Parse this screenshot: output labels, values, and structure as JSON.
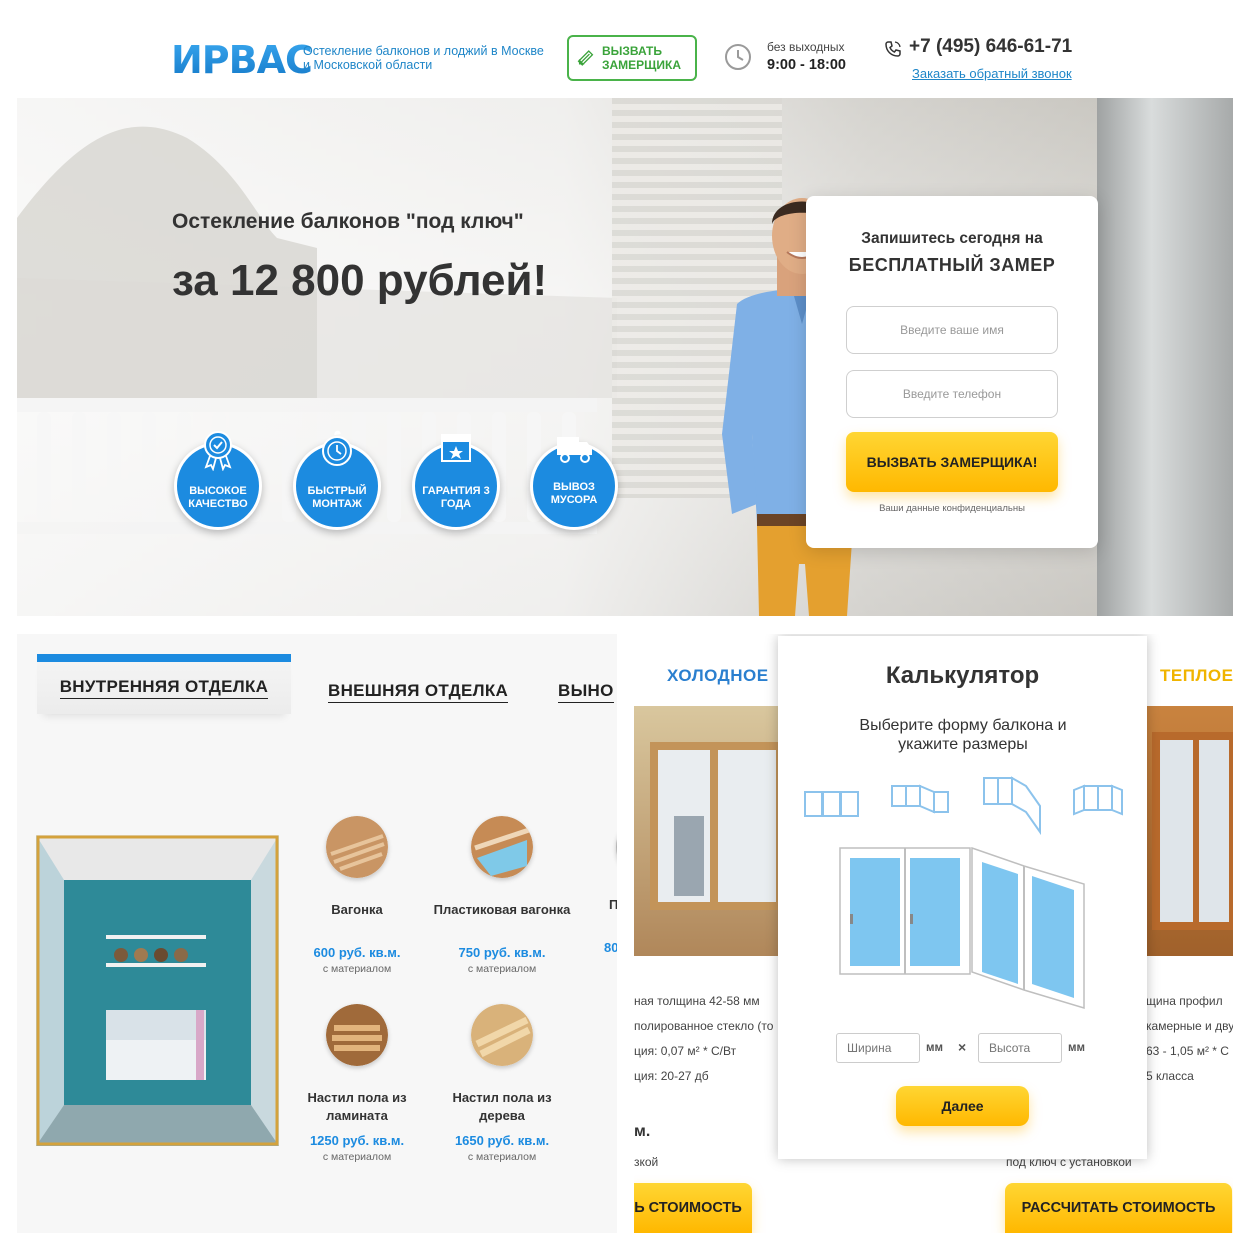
{
  "header": {
    "logo": "ИРВАС",
    "tagline": "Остекление балконов и лоджий в Москве и Московской области",
    "call_button": "ВЫЗВАТЬ ЗАМЕРЩИКА",
    "hours_label": "без выходных",
    "hours": "9:00 - 18:00",
    "phone": "+7 (495) 646-61-71",
    "callback": "Заказать обратный звонок"
  },
  "hero": {
    "subtitle": "Остекление балконов \"под ключ\"",
    "title": "за 12 800 рублей!",
    "badges": [
      {
        "icon": "award-icon",
        "label": "ВЫСОКОЕ КАЧЕСТВО"
      },
      {
        "icon": "timer-icon",
        "label": "БЫСТРЫЙ МОНТАЖ"
      },
      {
        "icon": "calendar-star-icon",
        "label": "ГАРАНТИЯ 3 ГОДА"
      },
      {
        "icon": "truck-icon",
        "label": "ВЫВОЗ МУСОРА"
      }
    ]
  },
  "form": {
    "line1": "Запишитесь сегодня на",
    "line2": "БЕСПЛАТНЫЙ ЗАМЕР",
    "name_placeholder": "Введите ваше имя",
    "phone_placeholder": "Введите телефон",
    "submit": "ВЫЗВАТЬ ЗАМЕРЩИКА!",
    "note": "Ваши данные конфиденциальны"
  },
  "finish": {
    "tabs": [
      "ВНУТРЕННЯЯ ОТДЕЛКА",
      "ВНЕШНЯЯ ОТДЕЛКА",
      "ВЫНО"
    ],
    "materials": [
      {
        "name": "Вагонка",
        "price": "600 руб. кв.м.",
        "sub": "с материалом"
      },
      {
        "name": "Пластиковая вагонка",
        "price": "750 руб. кв.м.",
        "sub": "с материалом"
      },
      {
        "name": "Настил пола из ламината",
        "price": "1250 руб. кв.м.",
        "sub": "с материалом"
      },
      {
        "name": "Настил пола из дерева",
        "price": "1650 руб. кв.м.",
        "sub": "с материалом"
      }
    ],
    "partial": {
      "name": "П",
      "price": "80"
    }
  },
  "glazing": {
    "cold": "ХОЛОДНОЕ",
    "warm": "ТЕПЛОЕ",
    "left_specs": [
      "ная толщина 42-58 мм",
      "полированное стекло (то",
      "ция: 0,07 м² * С/Вт",
      "ция: 20-27 дб"
    ],
    "left_bold": "м.",
    "left_small": "зкой",
    "right_specs": [
      "щина профил",
      "камерные и дву",
      "63 - 1,05 м² * С",
      "5 класса"
    ],
    "right_small": "под ключ с установкой",
    "left_button": "Ь СТОИМОСТЬ",
    "right_button": "РАССЧИТАТЬ СТОИМОСТЬ"
  },
  "calculator": {
    "close": "×",
    "title": "Калькулятор",
    "subtitle": "Выберите форму балкона и укажите размеры",
    "width_placeholder": "Ширина",
    "height_placeholder": "Высота",
    "unit": "мм",
    "times": "×",
    "next": "Далее"
  }
}
